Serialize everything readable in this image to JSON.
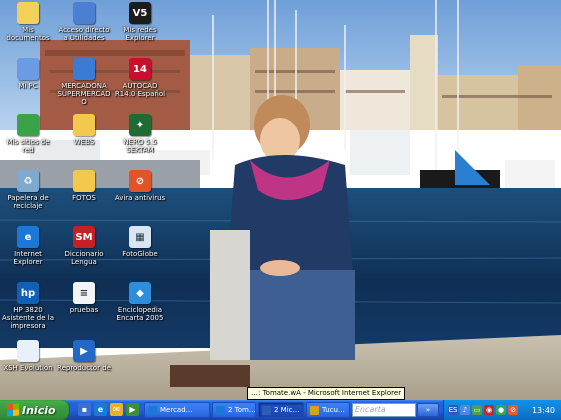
{
  "desktop": {
    "icons": [
      {
        "label": "Mis documentos",
        "icon": "folder-documents-icon",
        "color": "#f2d15b",
        "glyph": ""
      },
      {
        "label": "Acceso directo a Utilidades",
        "icon": "shortcut-icon",
        "color": "#4a7fd4",
        "glyph": ""
      },
      {
        "label": "Mis redes Explorer",
        "icon": "vlc-icon",
        "color": "#1c1c1c",
        "glyph": "V5"
      },
      {
        "label": "Mi PC",
        "icon": "my-computer-icon",
        "color": "#6c9be6",
        "glyph": ""
      },
      {
        "label": "MERCADONA SUPERMERCADO",
        "icon": "ie-shortcut-icon",
        "color": "#3a7bd5",
        "glyph": ""
      },
      {
        "label": "AUTOCAD R14.0 Español",
        "icon": "autocad-icon",
        "color": "#c8102e",
        "glyph": "14"
      },
      {
        "label": "Mis sitios de red",
        "icon": "network-places-icon",
        "color": "#3aa34a",
        "glyph": ""
      },
      {
        "label": "WEBS",
        "icon": "folder-icon",
        "color": "#f2c94c",
        "glyph": ""
      },
      {
        "label": "NERO 5.5 SEKTAM",
        "icon": "nero-icon",
        "color": "#1e6b33",
        "glyph": "✦"
      },
      {
        "label": "Papelera de reciclaje",
        "icon": "recycle-bin-icon",
        "color": "#7fa9cf",
        "glyph": "♻"
      },
      {
        "label": "FOTOS",
        "icon": "folder-icon",
        "color": "#f2c94c",
        "glyph": ""
      },
      {
        "label": "Avira antivirus",
        "icon": "antivirus-icon",
        "color": "#e0542a",
        "glyph": "⊘"
      },
      {
        "label": "Internet Explorer",
        "icon": "internet-explorer-icon",
        "color": "#1c78d6",
        "glyph": "e"
      },
      {
        "label": "Diccionario Lengua",
        "icon": "dictionary-icon",
        "color": "#c32027",
        "glyph": "SM"
      },
      {
        "label": "FotoGlobe",
        "icon": "photo-app-icon",
        "color": "#d9e6f2",
        "glyph": "▦"
      },
      {
        "label": "HP 3820 Asistente de la impresora",
        "icon": "hp-printer-icon",
        "color": "#1160b8",
        "glyph": "hp"
      },
      {
        "label": "pruebas",
        "icon": "document-icon",
        "color": "#f4f4f4",
        "glyph": "≡"
      },
      {
        "label": "Enciclopedia Encarta 2005",
        "icon": "encarta-icon",
        "color": "#2e8ede",
        "glyph": "◆"
      },
      {
        "label": "XSH Evolution",
        "icon": "windows-logo-icon",
        "color": "#e8f0fa",
        "glyph": ""
      },
      {
        "label": "Reproductor de",
        "icon": "media-player-icon",
        "color": "#2368c4",
        "glyph": "▶"
      }
    ]
  },
  "tooltip": {
    "text": "…: Tomate.wA - Microsoft Internet Explorer"
  },
  "taskbar": {
    "start_label": "Inicio",
    "quicklaunch": [
      {
        "icon": "show-desktop-icon",
        "color": "#3a6fd8",
        "glyph": "▪"
      },
      {
        "icon": "internet-explorer-icon",
        "color": "#1c78d6",
        "glyph": "e"
      },
      {
        "icon": "outlook-icon",
        "color": "#e6b22e",
        "glyph": "✉"
      },
      {
        "icon": "media-player-icon",
        "color": "#3a8f3a",
        "glyph": "▶"
      }
    ],
    "tasks": [
      {
        "label": "Mercad…",
        "icon": "explorer-window-icon",
        "color": "#1c78d6",
        "active": false
      },
      {
        "label": "2 Tom…",
        "icon": "explorer-window-icon",
        "color": "#1c78d6",
        "active": false
      },
      {
        "label": "2 Mic…",
        "icon": "word-icon",
        "color": "#2b5db8",
        "active": true
      },
      {
        "label": "Tucu…",
        "icon": "paint-icon",
        "color": "#d6a21c",
        "active": false
      }
    ],
    "search_placeholder": "Encarta",
    "search_button": "»",
    "tray_icons": [
      {
        "icon": "language-bar-icon",
        "color": "#2b5db8",
        "glyph": "ES"
      },
      {
        "icon": "volume-icon",
        "color": "#5588dd",
        "glyph": "♪"
      },
      {
        "icon": "network-icon",
        "color": "#4ca04c",
        "glyph": "▭"
      },
      {
        "icon": "security-icon",
        "color": "#c62828",
        "glyph": "◉"
      },
      {
        "icon": "messenger-icon",
        "color": "#35a853",
        "glyph": "●"
      },
      {
        "icon": "antivirus-tray-icon",
        "color": "#e35d2b",
        "glyph": "⊘"
      }
    ],
    "clock": "13:40"
  }
}
